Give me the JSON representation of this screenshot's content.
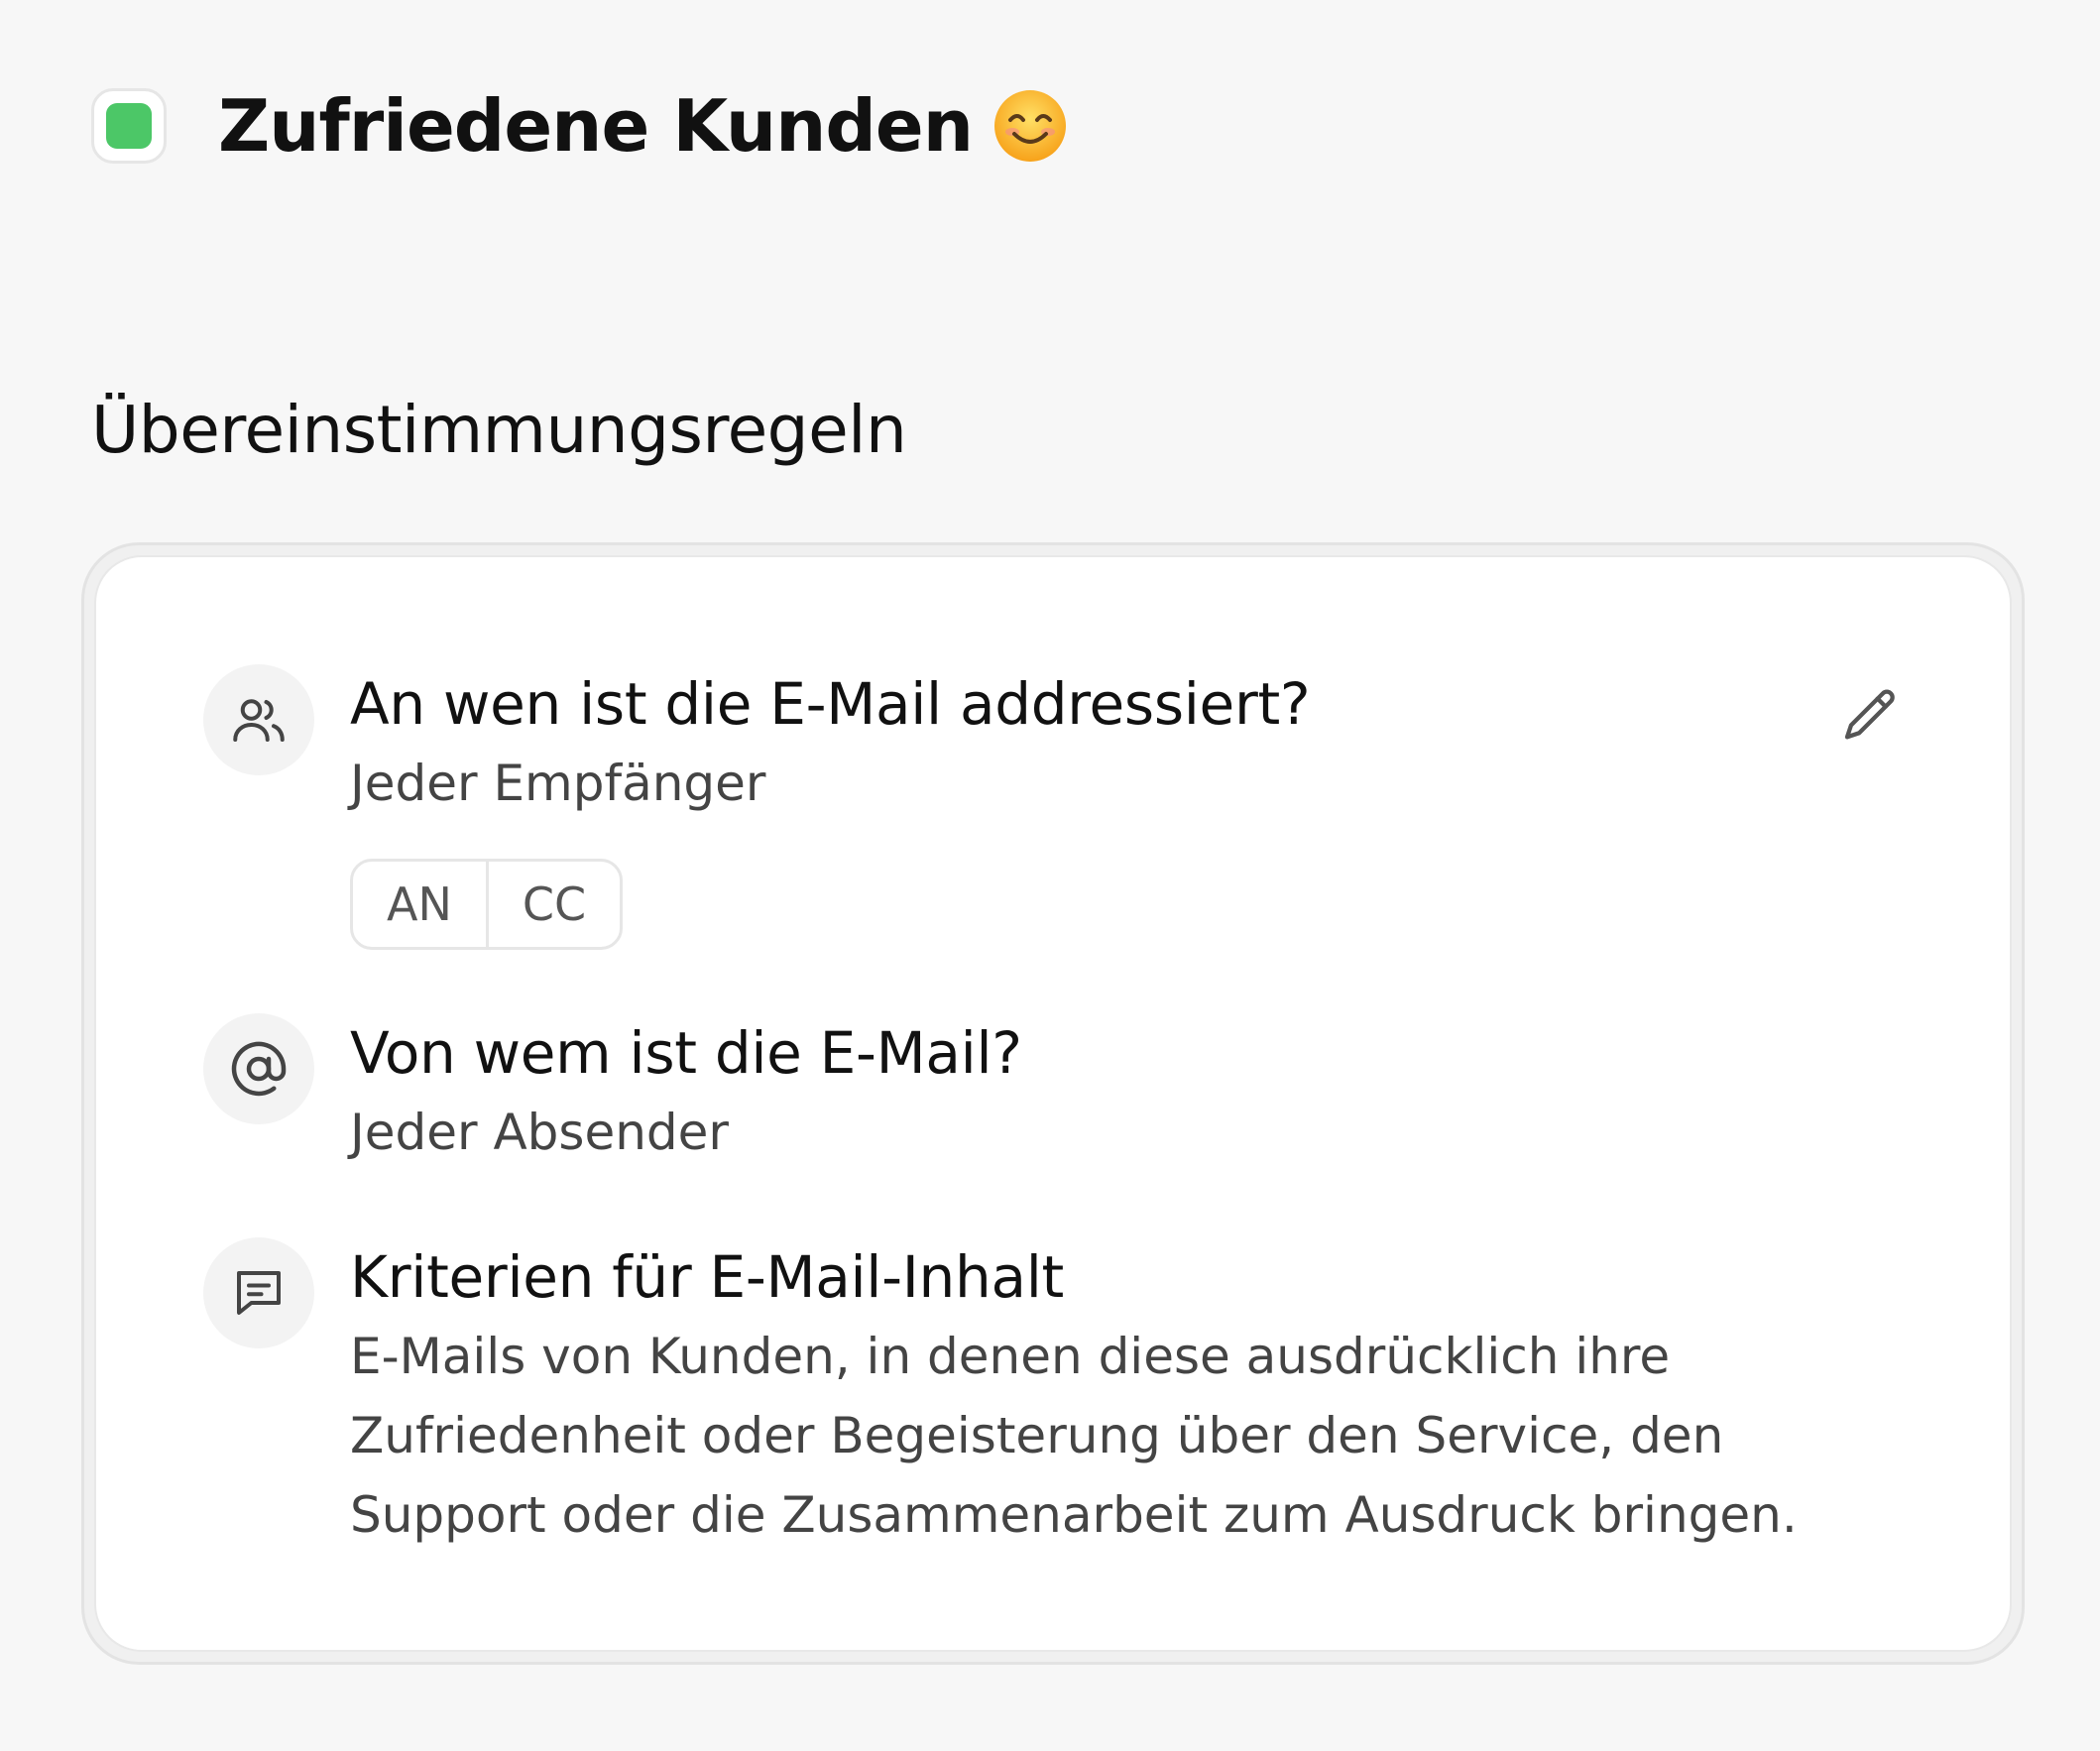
{
  "header": {
    "title": "Zufriedene Kunden",
    "label_color": "#4cc767",
    "emoji_icon": "smiling-face-icon"
  },
  "section": {
    "heading": "Übereinstimmungsregeln"
  },
  "rules": [
    {
      "icon": "people-icon",
      "title": "An wen ist die E-Mail addressiert?",
      "value": "Jeder Empfänger",
      "toggle": [
        "AN",
        "CC"
      ]
    },
    {
      "icon": "at-sign-icon",
      "title": "Von wem ist die E-Mail?",
      "value": "Jeder Absender"
    },
    {
      "icon": "message-icon",
      "title": "Kriterien für E-Mail-Inhalt",
      "value": "E-Mails von Kunden, in denen diese ausdrücklich ihre Zufriedenheit oder Begeisterung über den Service, den Support oder die Zusammenarbeit zum Ausdruck bringen."
    }
  ],
  "edit_icon": "pencil-icon"
}
